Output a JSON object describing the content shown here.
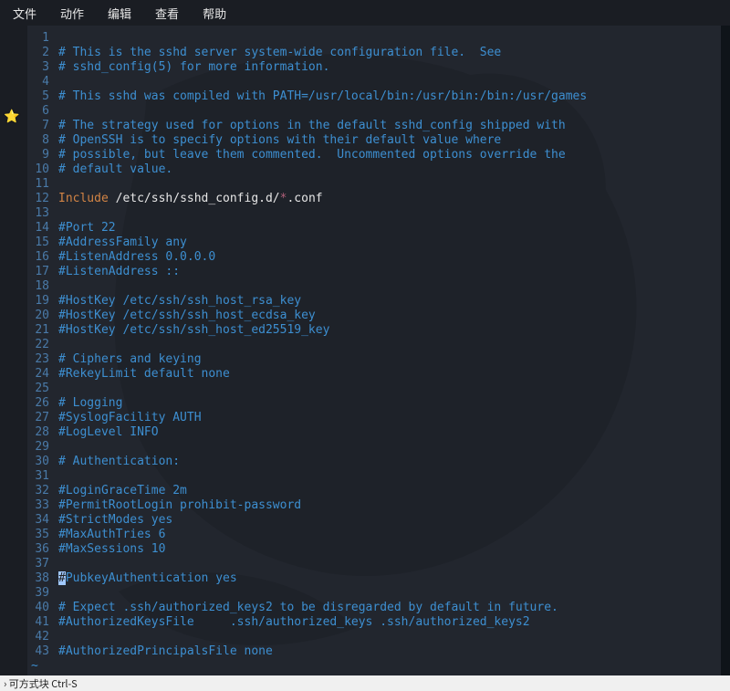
{
  "menubar": {
    "items": [
      "文件",
      "动作",
      "编辑",
      "查看",
      "帮助"
    ]
  },
  "gutter": {
    "star_icon": "⭐"
  },
  "editor": {
    "lines": [
      {
        "n": 1,
        "kind": "blank"
      },
      {
        "n": 2,
        "kind": "comment",
        "text": "# This is the sshd server system-wide configuration file.  See"
      },
      {
        "n": 3,
        "kind": "comment",
        "text": "# sshd_config(5) for more information."
      },
      {
        "n": 4,
        "kind": "blank"
      },
      {
        "n": 5,
        "kind": "comment",
        "text": "# This sshd was compiled with PATH=/usr/local/bin:/usr/bin:/bin:/usr/games"
      },
      {
        "n": 6,
        "kind": "blank"
      },
      {
        "n": 7,
        "kind": "comment",
        "text": "# The strategy used for options in the default sshd_config shipped with"
      },
      {
        "n": 8,
        "kind": "comment",
        "text": "# OpenSSH is to specify options with their default value where"
      },
      {
        "n": 9,
        "kind": "comment",
        "text": "# possible, but leave them commented.  Uncommented options override the"
      },
      {
        "n": 10,
        "kind": "comment",
        "text": "# default value."
      },
      {
        "n": 11,
        "kind": "blank"
      },
      {
        "n": 12,
        "kind": "include",
        "keyword": "Include",
        "path": " /etc/ssh/sshd_config.d/",
        "glob": "*",
        "ext": ".conf"
      },
      {
        "n": 13,
        "kind": "blank"
      },
      {
        "n": 14,
        "kind": "comment",
        "text": "#Port 22"
      },
      {
        "n": 15,
        "kind": "comment",
        "text": "#AddressFamily any"
      },
      {
        "n": 16,
        "kind": "comment",
        "text": "#ListenAddress 0.0.0.0"
      },
      {
        "n": 17,
        "kind": "comment",
        "text": "#ListenAddress ::"
      },
      {
        "n": 18,
        "kind": "blank"
      },
      {
        "n": 19,
        "kind": "comment",
        "text": "#HostKey /etc/ssh/ssh_host_rsa_key"
      },
      {
        "n": 20,
        "kind": "comment",
        "text": "#HostKey /etc/ssh/ssh_host_ecdsa_key"
      },
      {
        "n": 21,
        "kind": "comment",
        "text": "#HostKey /etc/ssh/ssh_host_ed25519_key"
      },
      {
        "n": 22,
        "kind": "blank"
      },
      {
        "n": 23,
        "kind": "comment",
        "text": "# Ciphers and keying"
      },
      {
        "n": 24,
        "kind": "comment",
        "text": "#RekeyLimit default none"
      },
      {
        "n": 25,
        "kind": "blank"
      },
      {
        "n": 26,
        "kind": "comment",
        "text": "# Logging"
      },
      {
        "n": 27,
        "kind": "comment",
        "text": "#SyslogFacility AUTH"
      },
      {
        "n": 28,
        "kind": "comment",
        "text": "#LogLevel INFO"
      },
      {
        "n": 29,
        "kind": "blank"
      },
      {
        "n": 30,
        "kind": "comment",
        "text": "# Authentication:"
      },
      {
        "n": 31,
        "kind": "blank"
      },
      {
        "n": 32,
        "kind": "comment",
        "text": "#LoginGraceTime 2m"
      },
      {
        "n": 33,
        "kind": "comment",
        "text": "#PermitRootLogin prohibit-password"
      },
      {
        "n": 34,
        "kind": "comment",
        "text": "#StrictModes yes"
      },
      {
        "n": 35,
        "kind": "comment",
        "text": "#MaxAuthTries 6"
      },
      {
        "n": 36,
        "kind": "comment",
        "text": "#MaxSessions 10"
      },
      {
        "n": 37,
        "kind": "blank"
      },
      {
        "n": 38,
        "kind": "cursor-comment",
        "cursor": "#",
        "rest": "PubkeyAuthentication yes"
      },
      {
        "n": 39,
        "kind": "blank"
      },
      {
        "n": 40,
        "kind": "comment",
        "text": "# Expect .ssh/authorized_keys2 to be disregarded by default in future."
      },
      {
        "n": 41,
        "kind": "comment",
        "text": "#AuthorizedKeysFile     .ssh/authorized_keys .ssh/authorized_keys2"
      },
      {
        "n": 42,
        "kind": "blank"
      },
      {
        "n": 43,
        "kind": "comment",
        "text": "#AuthorizedPrincipalsFile none"
      }
    ],
    "tilde": "~"
  },
  "statusbar": {
    "text": "› 可方式块 Ctrl-S"
  }
}
